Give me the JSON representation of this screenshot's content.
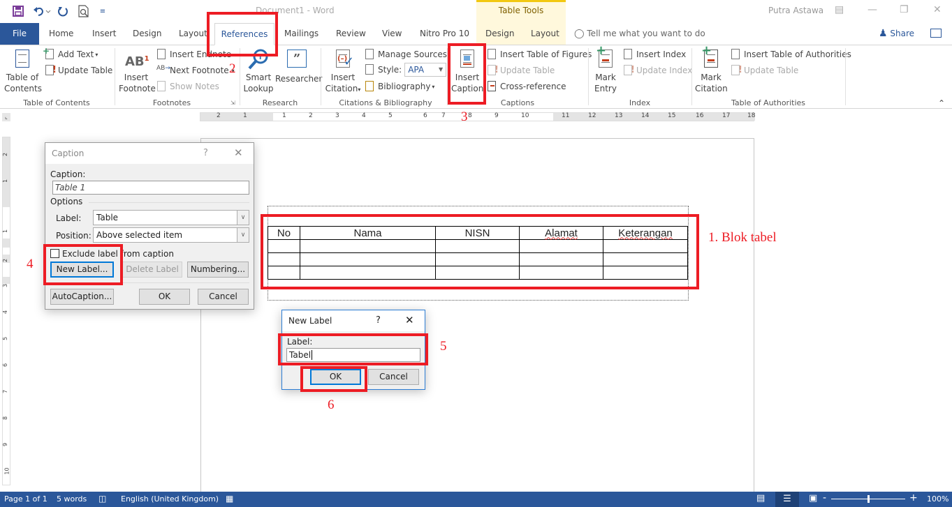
{
  "titlebar": {
    "document_title": "Document1  -  Word",
    "contextual_group": "Table Tools",
    "user_name": "Putra Astawa",
    "qat": [
      "save-icon",
      "undo-icon",
      "redo-icon",
      "print-preview-icon",
      "customize-qat-icon"
    ]
  },
  "tabs": {
    "items": [
      "File",
      "Home",
      "Insert",
      "Design",
      "Layout",
      "References",
      "Mailings",
      "Review",
      "View",
      "Nitro Pro 10",
      "Design",
      "Layout"
    ],
    "active": "References",
    "tell_me": "Tell me what you want to do",
    "share": "Share"
  },
  "ribbon": {
    "groups": {
      "toc": {
        "label": "Table of Contents",
        "table_of_contents": "Table of\nContents",
        "add_text": "Add Text",
        "update_table": "Update Table"
      },
      "footnotes": {
        "label": "Footnotes",
        "insert_footnote_1": "Insert",
        "insert_footnote_2": "Footnote",
        "insert_endnote": "Insert Endnote",
        "next_footnote": "Next Footnote",
        "show_notes": "Show Notes"
      },
      "research": {
        "label": "Research",
        "smart_lookup_1": "Smart",
        "smart_lookup_2": "Lookup",
        "researcher": "Researcher"
      },
      "citations": {
        "label": "Citations & Bibliography",
        "insert_citation_1": "Insert",
        "insert_citation_2": "Citation",
        "manage_sources": "Manage Sources",
        "style_label": "Style:",
        "style_value": "APA",
        "bibliography": "Bibliography"
      },
      "captions": {
        "label": "Captions",
        "insert_caption_1": "Insert",
        "insert_caption_2": "Caption",
        "insert_table_of_figures": "Insert Table of Figures",
        "update_table": "Update Table",
        "cross_reference": "Cross-reference"
      },
      "index": {
        "label": "Index",
        "mark_entry_1": "Mark",
        "mark_entry_2": "Entry",
        "insert_index": "Insert Index",
        "update_index": "Update Index"
      },
      "authorities": {
        "label": "Table of Authorities",
        "mark_citation_1": "Mark",
        "mark_citation_2": "Citation",
        "insert_toa": "Insert Table of Authorities",
        "update_table": "Update Table"
      }
    }
  },
  "ruler": {
    "h_numbers": [
      "2",
      "1",
      "1",
      "2",
      "3",
      "4",
      "5",
      "6",
      "7",
      "8",
      "9",
      "10",
      "11",
      "12",
      "13",
      "14",
      "15",
      "16",
      "17",
      "18"
    ],
    "v_numbers": [
      "2",
      "1",
      "1",
      "2",
      "3",
      "4",
      "5",
      "6",
      "7",
      "8",
      "9",
      "10"
    ]
  },
  "document": {
    "table": {
      "headers": [
        "No",
        "Nama",
        "NISN",
        "Alamat",
        "Keterangan"
      ],
      "rows": [
        [
          "",
          "",
          "",
          "",
          ""
        ],
        [
          "",
          "",
          "",
          "",
          ""
        ],
        [
          "",
          "",
          "",
          "",
          ""
        ]
      ]
    }
  },
  "caption_dialog": {
    "title": "Caption",
    "help": "?",
    "caption_label": "Caption:",
    "caption_value": "Table 1",
    "options_label": "Options",
    "label_label": "Label:",
    "label_value": "Table",
    "position_label": "Position:",
    "position_value": "Above selected item",
    "exclude_label": "Exclude label from caption",
    "exclude_checked": false,
    "new_label_btn": "New Label...",
    "delete_label_btn": "Delete Label",
    "numbering_btn": "Numbering...",
    "autocaption_btn": "AutoCaption...",
    "ok_btn": "OK",
    "cancel_btn": "Cancel"
  },
  "new_label_dialog": {
    "title": "New Label",
    "help": "?",
    "label_label": "Label:",
    "label_value": "Tabel",
    "ok_btn": "OK",
    "cancel_btn": "Cancel"
  },
  "annotations": {
    "step1": "1. Blok tabel",
    "step2": "2",
    "step3": "3",
    "step4": "4",
    "step5": "5",
    "step6": "6",
    "color": "#ed1c24"
  },
  "statusbar": {
    "page": "Page 1 of 1",
    "words": "5 words",
    "language": "English (United Kingdom)",
    "zoom": "100%",
    "zoom_percent": 100
  },
  "colors": {
    "accent": "#2b579a",
    "table_tools": "#f2c811",
    "dialog_default_border": "#0078d7"
  }
}
